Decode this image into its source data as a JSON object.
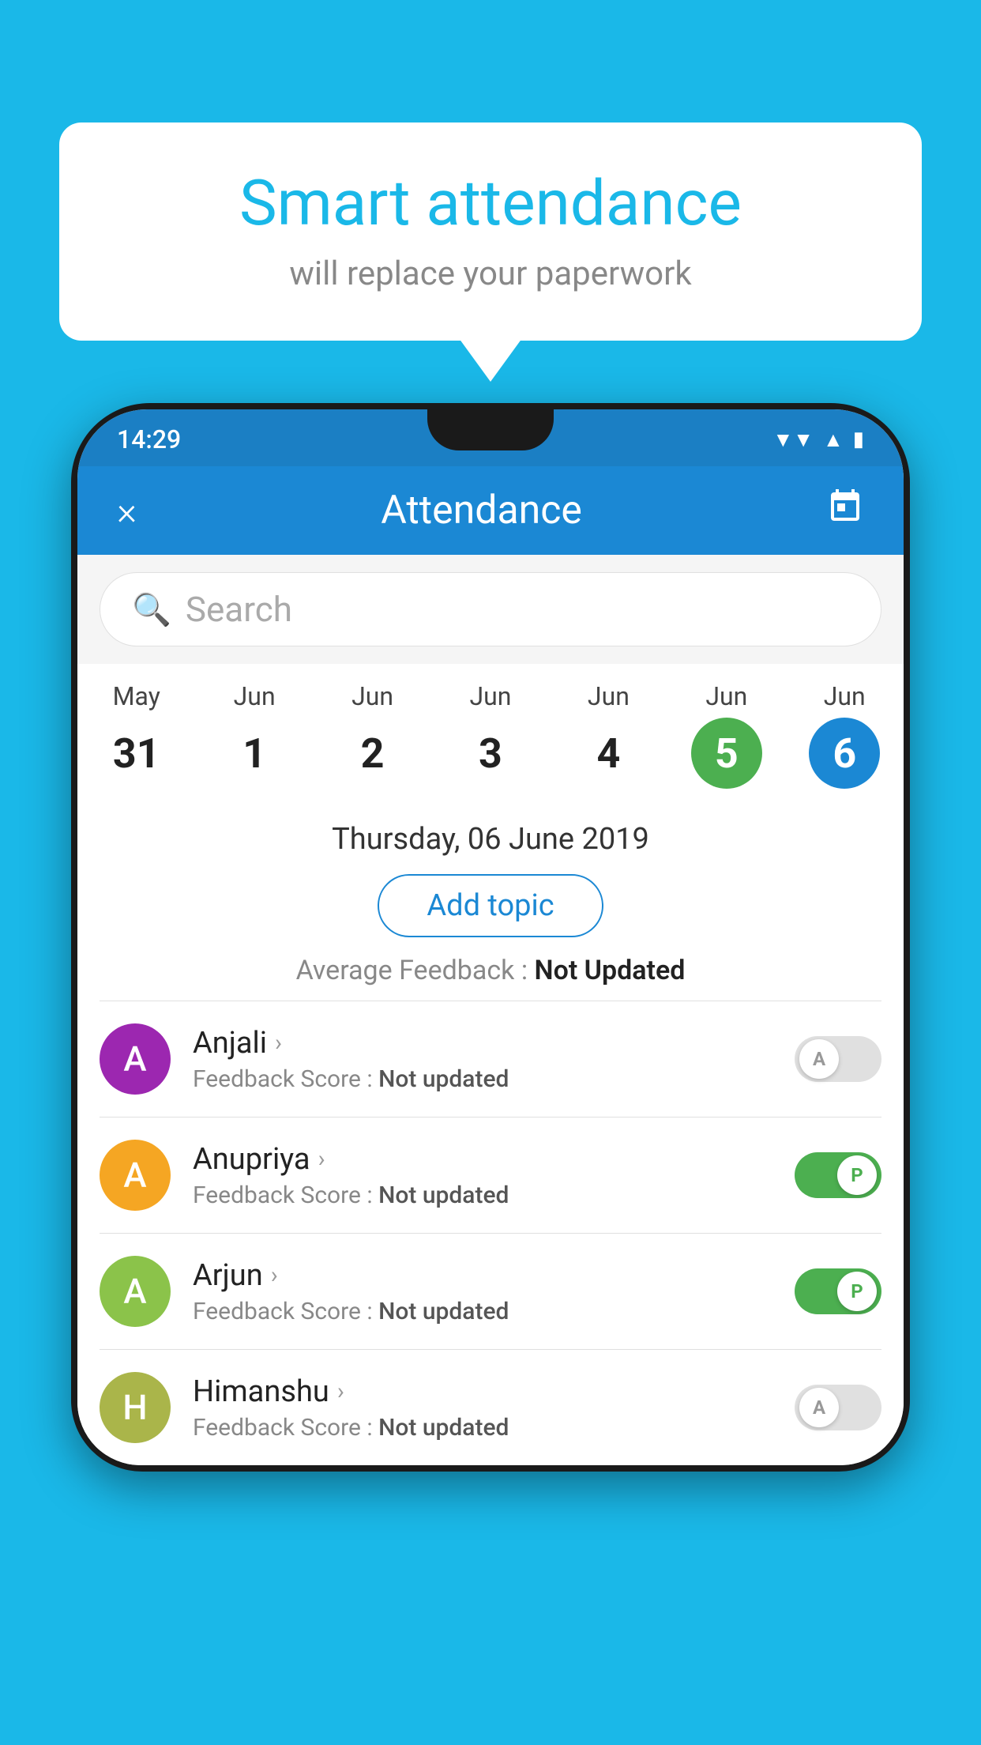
{
  "background_color": "#1ab8e8",
  "speech_bubble": {
    "title": "Smart attendance",
    "subtitle": "will replace your paperwork"
  },
  "status_bar": {
    "time": "14:29",
    "wifi": "▲",
    "signal": "▲",
    "battery": "▮"
  },
  "app_header": {
    "title": "Attendance",
    "close_label": "×",
    "calendar_icon": "📅"
  },
  "search": {
    "placeholder": "Search"
  },
  "dates": [
    {
      "month": "May",
      "day": "31",
      "active": false
    },
    {
      "month": "Jun",
      "day": "1",
      "active": false
    },
    {
      "month": "Jun",
      "day": "2",
      "active": false
    },
    {
      "month": "Jun",
      "day": "3",
      "active": false
    },
    {
      "month": "Jun",
      "day": "4",
      "active": false
    },
    {
      "month": "Jun",
      "day": "5",
      "active": "green"
    },
    {
      "month": "Jun",
      "day": "6",
      "active": "blue"
    }
  ],
  "selected_date": "Thursday, 06 June 2019",
  "add_topic_label": "Add topic",
  "average_feedback_label": "Average Feedback :",
  "average_feedback_value": "Not Updated",
  "students": [
    {
      "name": "Anjali",
      "avatar_letter": "A",
      "avatar_color": "#9c27b0",
      "feedback_label": "Feedback Score :",
      "feedback_value": "Not updated",
      "toggle_state": "off",
      "toggle_label": "A"
    },
    {
      "name": "Anupriya",
      "avatar_letter": "A",
      "avatar_color": "#f5a623",
      "feedback_label": "Feedback Score :",
      "feedback_value": "Not updated",
      "toggle_state": "on",
      "toggle_label": "P"
    },
    {
      "name": "Arjun",
      "avatar_letter": "A",
      "avatar_color": "#8bc34a",
      "feedback_label": "Feedback Score :",
      "feedback_value": "Not updated",
      "toggle_state": "on",
      "toggle_label": "P"
    },
    {
      "name": "Himanshu",
      "avatar_letter": "H",
      "avatar_color": "#aab54a",
      "feedback_label": "Feedback Score :",
      "feedback_value": "Not updated",
      "toggle_state": "off",
      "toggle_label": "A"
    }
  ]
}
